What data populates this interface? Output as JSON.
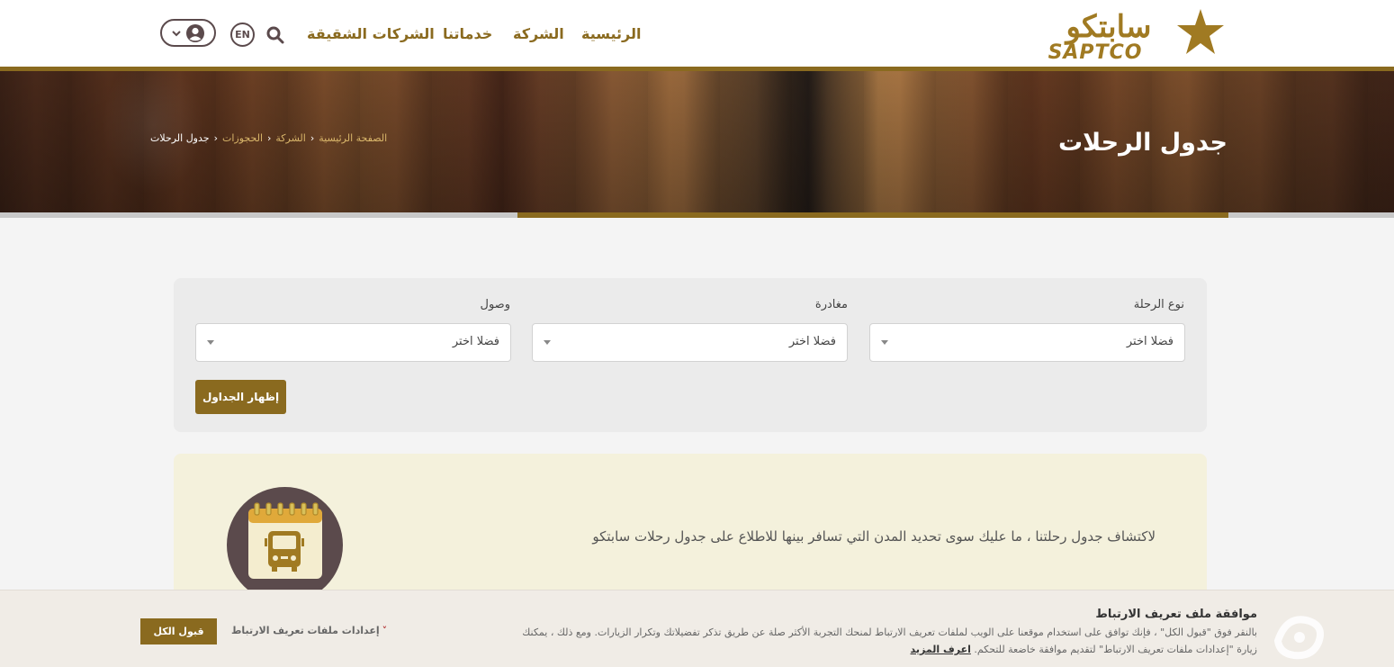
{
  "header": {
    "logo_text_ar": "سابتكو",
    "logo_text_en": "SAPTCO",
    "nav": [
      "الرئيسية",
      "الشركة",
      "خدماتنا",
      "الشركات الشقيقة"
    ],
    "lang": "EN",
    "icons": {
      "search": "search-icon",
      "user": "user-icon",
      "dropdown": "chevron-down-icon"
    }
  },
  "banner": {
    "title": "جدول الرحلات",
    "breadcrumb": [
      "الصفحة الرئيسية",
      "الشركة",
      "الحجوزات",
      "جدول الرحلات"
    ]
  },
  "search_form": {
    "trip_type_label": "نوع الرحلة",
    "trip_type_value": "فضلا اختر",
    "departure_label": "مغادرة",
    "departure_value": "فضلا اختر",
    "arrival_label": "وصول",
    "arrival_value": "فضلا اختر",
    "show_button": "إظهار الجداول"
  },
  "info": {
    "text": "لاكتشاف جدول رحلتنا ، ما عليك سوى تحديد المدن التي تسافر بينها للاطلاع على جدول رحلات سابتكو",
    "icon": "calendar-bus-icon"
  },
  "cookie": {
    "title": "موافقة ملف تعريف الارتباط",
    "line1": "بالنقر فوق \"قبول الكل\" ، فإنك توافق على استخدام موقعنا على الويب لملفات تعريف الارتباط لمنحك التجربة الأكثر صلة عن طريق تذكر تفضيلاتك وتكرار الزيارات. ومع ذلك ، يمكنك",
    "line2": "زيارة \"إعدادات ملفات تعريف الارتباط\" لتقديم موافقة خاضعة للتحكم.",
    "learn_more": "اعرف المزيد",
    "settings": "إعدادات ملفات تعريف الارتباط",
    "accept_all": "قبول الكل"
  },
  "colors": {
    "brand_gold": "#8a6a1f",
    "brand_dark": "#5b4a4c",
    "info_bg": "#f4f1dc"
  }
}
